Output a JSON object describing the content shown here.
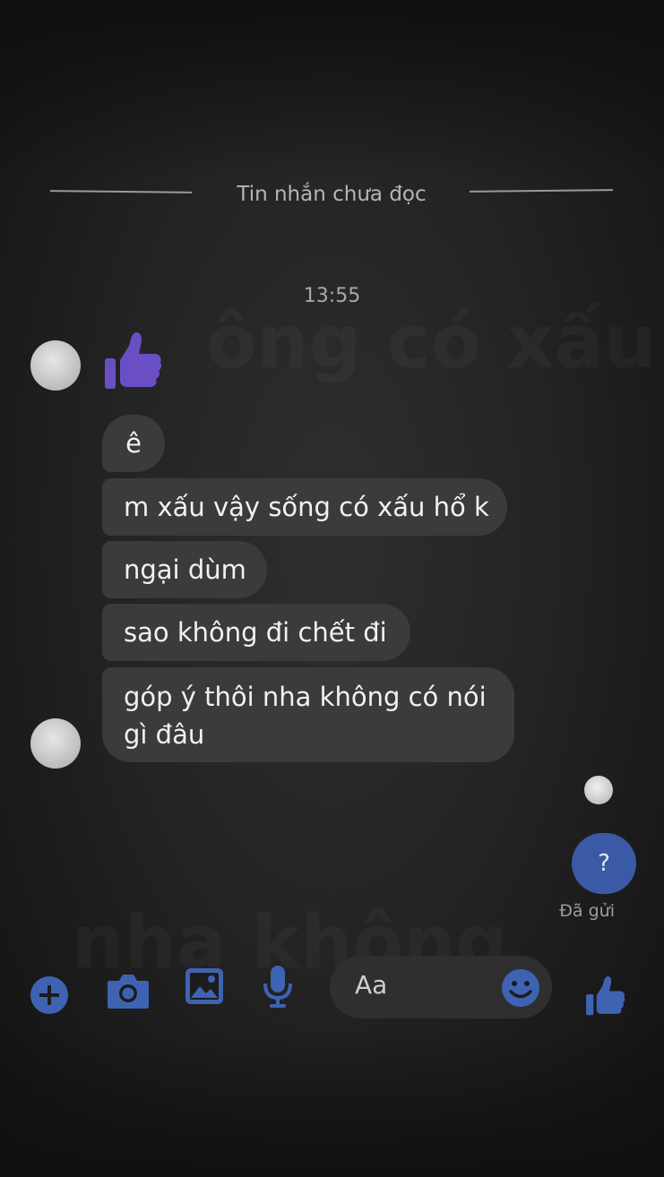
{
  "divider": {
    "unread_label": "Tin nhắn chưa đọc"
  },
  "timestamp": "13:55",
  "messages": [
    {
      "text": "ê"
    },
    {
      "text": "m xấu vậy sống có xấu hổ k"
    },
    {
      "text": "ngại dùm"
    },
    {
      "text": "sao không đi chết đi"
    },
    {
      "text": "góp ý thôi nha không có nói gì đâu"
    }
  ],
  "sent": {
    "bubble_text": "?",
    "status": "Đã gửi"
  },
  "composer": {
    "placeholder": "Aa"
  },
  "ghost_text": {
    "line1": "ông có xấu",
    "line2": "nha không"
  },
  "colors": {
    "accent": "#3a5aa6",
    "sticker": "#6a4fc4",
    "bubble": "#3b3b3b",
    "icon_blue": "#3f63b3"
  },
  "icons": {
    "sticker": "thumbs-up-icon",
    "add": "plus-circle-icon",
    "camera": "camera-icon",
    "gallery": "image-icon",
    "mic": "microphone-icon",
    "emoji": "smiley-icon",
    "like": "thumbs-up-icon"
  }
}
